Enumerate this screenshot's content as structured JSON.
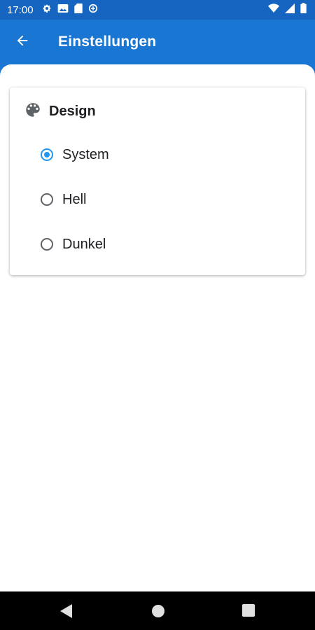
{
  "status_bar": {
    "time": "17:00",
    "left_icons": [
      "settings-gear-icon",
      "image-icon",
      "sd-card-icon",
      "data-saver-icon"
    ],
    "right_icons": [
      "wifi-icon",
      "signal-icon",
      "battery-icon"
    ]
  },
  "app_bar": {
    "title": "Einstellungen",
    "back_icon": "arrow-back-icon"
  },
  "design_card": {
    "icon": "palette-icon",
    "title": "Design",
    "options": [
      {
        "label": "System",
        "selected": true
      },
      {
        "label": "Hell",
        "selected": false
      },
      {
        "label": "Dunkel",
        "selected": false
      }
    ]
  },
  "nav_bar": {
    "buttons": [
      "back-triangle-icon",
      "home-circle-icon",
      "recents-square-icon"
    ]
  },
  "colors": {
    "status_bar": "#1565c0",
    "app_bar": "#1976d2",
    "accent": "#2196f3",
    "nav_bar": "#000000"
  }
}
